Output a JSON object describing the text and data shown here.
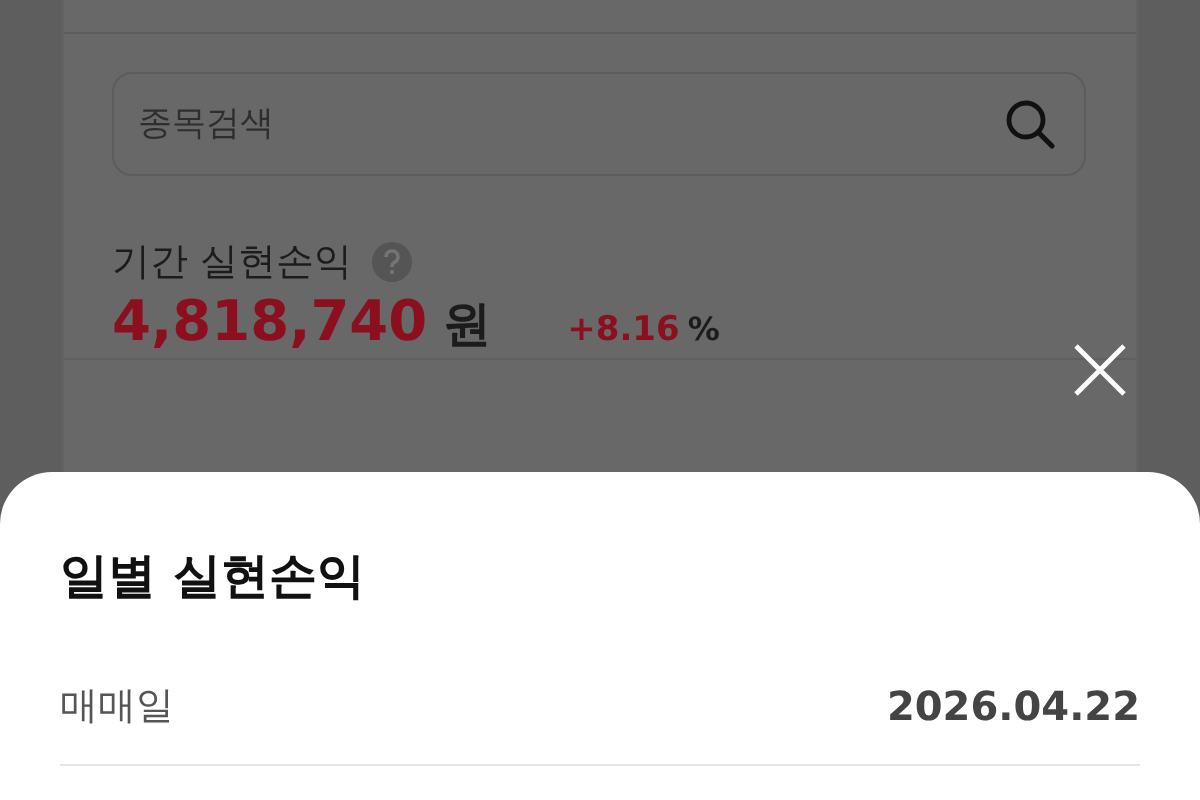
{
  "search": {
    "placeholder": "종목검색"
  },
  "summary": {
    "label": "기간 실현손익",
    "amount": "4,818,740",
    "unit": "원",
    "rate": "+8.16",
    "rate_unit": "%"
  },
  "sheet": {
    "title": "일별 실현손익",
    "rows": [
      {
        "label": "매매일",
        "value": "2026.04.22"
      }
    ]
  }
}
